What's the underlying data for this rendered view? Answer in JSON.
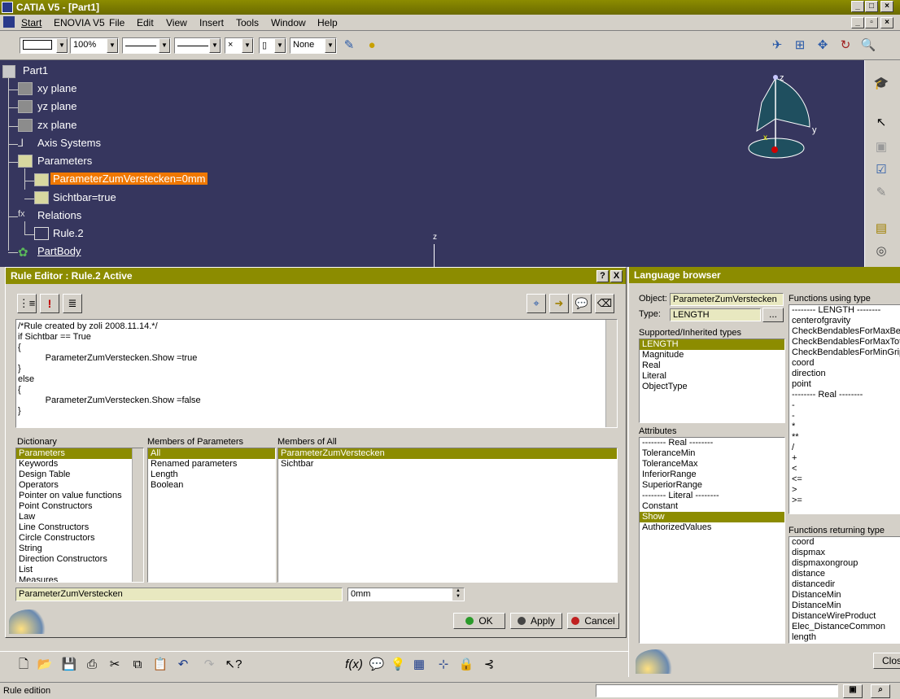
{
  "window": {
    "title": "CATIA V5 - [Part1]"
  },
  "menu": [
    "Start",
    "ENOVIA V5",
    "File",
    "Edit",
    "View",
    "Insert",
    "Tools",
    "Window",
    "Help"
  ],
  "toolbar": {
    "zoom": "100%",
    "none_value": "None"
  },
  "tree": {
    "root": "Part1",
    "items": [
      {
        "label": "xy plane"
      },
      {
        "label": "yz plane"
      },
      {
        "label": "zx plane"
      },
      {
        "label": "Axis Systems"
      },
      {
        "label": "Parameters"
      },
      {
        "label": "ParameterZumVerstecken=0mm"
      },
      {
        "label": "Sichtbar=true"
      },
      {
        "label": "Relations"
      },
      {
        "label": "Rule.2"
      },
      {
        "label": "PartBody"
      }
    ],
    "compass_axes": {
      "x": "x",
      "y": "y",
      "z": "z"
    },
    "viewport_z": "z"
  },
  "rule_editor": {
    "title": "Rule Editor : Rule.2 Active",
    "help": "?",
    "close": "X",
    "code": [
      "/*Rule created by zoli 2008.11.14.*/",
      "",
      "if Sichtbar == True",
      "{",
      "           ParameterZumVerstecken.Show =true",
      "}",
      "else",
      "{",
      "           ParameterZumVerstecken.Show =false",
      "}"
    ],
    "dictionary_label": "Dictionary",
    "dictionary": [
      "Parameters",
      "Keywords",
      "Design Table",
      "Operators",
      "Pointer on value functions",
      "Point Constructors",
      "Law",
      "Line Constructors",
      "Circle Constructors",
      "String",
      "Direction Constructors",
      "List",
      "Measures"
    ],
    "members_params_label": "Members of Parameters",
    "members_params": [
      "All",
      "Renamed parameters",
      "Length",
      "Boolean"
    ],
    "members_all_label": "Members of All",
    "members_all": [
      "ParameterZumVerstecken",
      "Sichtbar"
    ],
    "selected_param": "ParameterZumVerstecken",
    "value": "0mm",
    "ok": "OK",
    "apply": "Apply",
    "cancel": "Cancel"
  },
  "language_browser": {
    "title": "Language browser",
    "object_label": "Object:",
    "object_value": "ParameterZumVerstecken",
    "type_label": "Type:",
    "type_value": "LENGTH",
    "browse": "...",
    "supported_label": "Supported/Inherited types",
    "supported": [
      "LENGTH",
      "Magnitude",
      "Real",
      "Literal",
      "ObjectType"
    ],
    "attributes_label": "Attributes",
    "attributes": [
      "-------- Real --------",
      "ToleranceMin",
      "ToleranceMax",
      "InferiorRange",
      "SuperiorRange",
      "-------- Literal --------",
      "Constant",
      "Show",
      "AuthorizedValues"
    ],
    "functions_using_label": "Functions using type",
    "functions_using": [
      "-------- LENGTH --------",
      "centerofgravity",
      "CheckBendablesForMaxBen",
      "CheckBendablesForMaxTota",
      "CheckBendablesForMinGrip",
      "coord",
      "direction",
      "point",
      "-------- Real --------",
      "-",
      "-",
      "*",
      "**",
      "/",
      "+",
      "<",
      "<=",
      ">",
      ">="
    ],
    "functions_returning_label": "Functions returning type",
    "functions_returning": [
      "coord",
      "dispmax",
      "dispmaxongroup",
      "distance",
      "distancedir",
      "DistanceMin",
      "DistanceMin",
      "DistanceWireProduct",
      "Elec_DistanceCommon",
      "length"
    ],
    "close": "Close"
  },
  "status": {
    "text": "Rule edition"
  }
}
